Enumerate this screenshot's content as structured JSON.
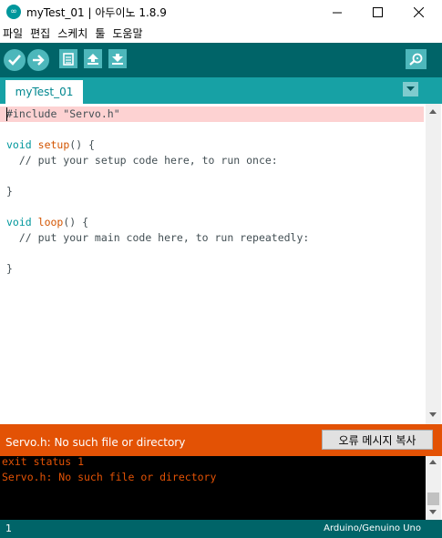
{
  "window": {
    "title": "myTest_01 | 아두이노 1.8.9",
    "app_icon_glyph": "∞"
  },
  "menu": [
    "파일",
    "편집",
    "스케치",
    "툴",
    "도움말"
  ],
  "toolbar": {
    "buttons": [
      "verify",
      "upload",
      "new",
      "open",
      "save"
    ],
    "right_button": "serial-monitor",
    "colors": {
      "bar": "#006468",
      "button": "#4db7bb"
    }
  },
  "tab": {
    "label": "myTest_01"
  },
  "editor": {
    "line1": "#include \"Servo.h\"",
    "setup_keyword": "void",
    "setup_name": "setup",
    "setup_rest": "() {",
    "setup_comment": "  // put your setup code here, to run once:",
    "brace": "}",
    "loop_keyword": "void",
    "loop_name": "loop",
    "loop_rest": "() {",
    "loop_comment": "  // put your main code here, to run repeatedly:"
  },
  "error": {
    "message": "Servo.h: No such file or directory",
    "copy_button": "오류 메시지 복사",
    "color": "#e35205"
  },
  "console": {
    "lines": [
      "exit status 1",
      "Servo.h: No such file or directory"
    ]
  },
  "status": {
    "line_number": "1",
    "board": "Arduino/Genuino Uno"
  }
}
